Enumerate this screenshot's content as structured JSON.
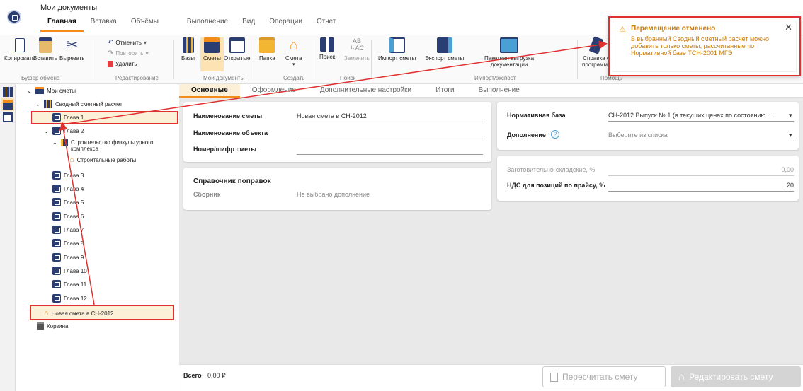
{
  "app": {
    "title": "Мои документы"
  },
  "menu_tabs": [
    "Главная",
    "Вставка",
    "Объёмы",
    "Выполнение",
    "Вид",
    "Операции",
    "Отчет"
  ],
  "ribbon": {
    "copy": "Копировать",
    "paste": "Вставить",
    "cut": "Вырезать",
    "undo": "Отменить",
    "redo": "Повторить",
    "delete": "Удалить",
    "bases": "Базы",
    "estimates": "Сметы",
    "opened": "Открытые",
    "folder": "Папка",
    "estimate_new": "Смета",
    "search": "Поиск",
    "replace": "Заменить",
    "import_est": "Импорт сметы",
    "export_est": "Экспорт сметы",
    "batch_export_1": "Пакетная выгрузка",
    "batch_export_2": "документации",
    "help_1": "Справка о",
    "help_2": "программе",
    "groups": {
      "clipboard": "Буфер обмена",
      "editing": "Редактирование",
      "mydocs": "Мои документы",
      "create": "Создать",
      "search": "Поиск",
      "importexport": "Импорт/экспорт",
      "help": "Помощь"
    }
  },
  "tree": {
    "root": "Мои сметы",
    "summary": "Сводный сметный расчет",
    "ch1": "Глава 1",
    "ch2": "Глава 2",
    "object_1": "Строительство физкультурного",
    "object_2": "комплекса",
    "works": "Строительные работы",
    "chapters": [
      "Глава 3",
      "Глава 4",
      "Глава 5",
      "Глава 6",
      "Глава 7",
      "Глава 8",
      "Глава 9",
      "Глава 10",
      "Глава 11",
      "Глава 12"
    ],
    "new_est": "Новая смета в СН-2012",
    "trash": "Корзина"
  },
  "subtabs": [
    "Основные",
    "Оформление",
    "Дополнительные настройки",
    "Итоги",
    "Выполнение"
  ],
  "form": {
    "name_label": "Наименование сметы",
    "name_value": "Новая смета в СН-2012",
    "object_label": "Наименование объекта",
    "number_label": "Номер/шифр сметы",
    "base_label": "Нормативная база",
    "base_value": "СН-2012 Выпуск № 1 (в текущих ценах по состоянию ...",
    "add_label": "Дополнение",
    "add_placeholder": "Выберите из списка",
    "corr_title": "Справочник поправок",
    "corr_label": "Сборник",
    "corr_value": "Не выбрано дополнение",
    "storage_label": "Заготовительно-складские, %",
    "storage_value": "0,00",
    "vat_label": "НДС для позиций по прайсу, %",
    "vat_value": "20"
  },
  "footer": {
    "total_label": "Всего",
    "total_value": "0,00 ₽",
    "recalc": "Пересчитать смету",
    "edit": "Редактировать смету"
  },
  "toast": {
    "title": "Перемещение отменено",
    "text": "В выбранный Сводный сметный расчет можно добавить только сметы, рассчитанные по Нормативной базе ТСН-2001 МГЭ"
  },
  "colors": {
    "accent": "#f28c1a",
    "brand": "#2b3e73",
    "annotation": "#e03030"
  }
}
